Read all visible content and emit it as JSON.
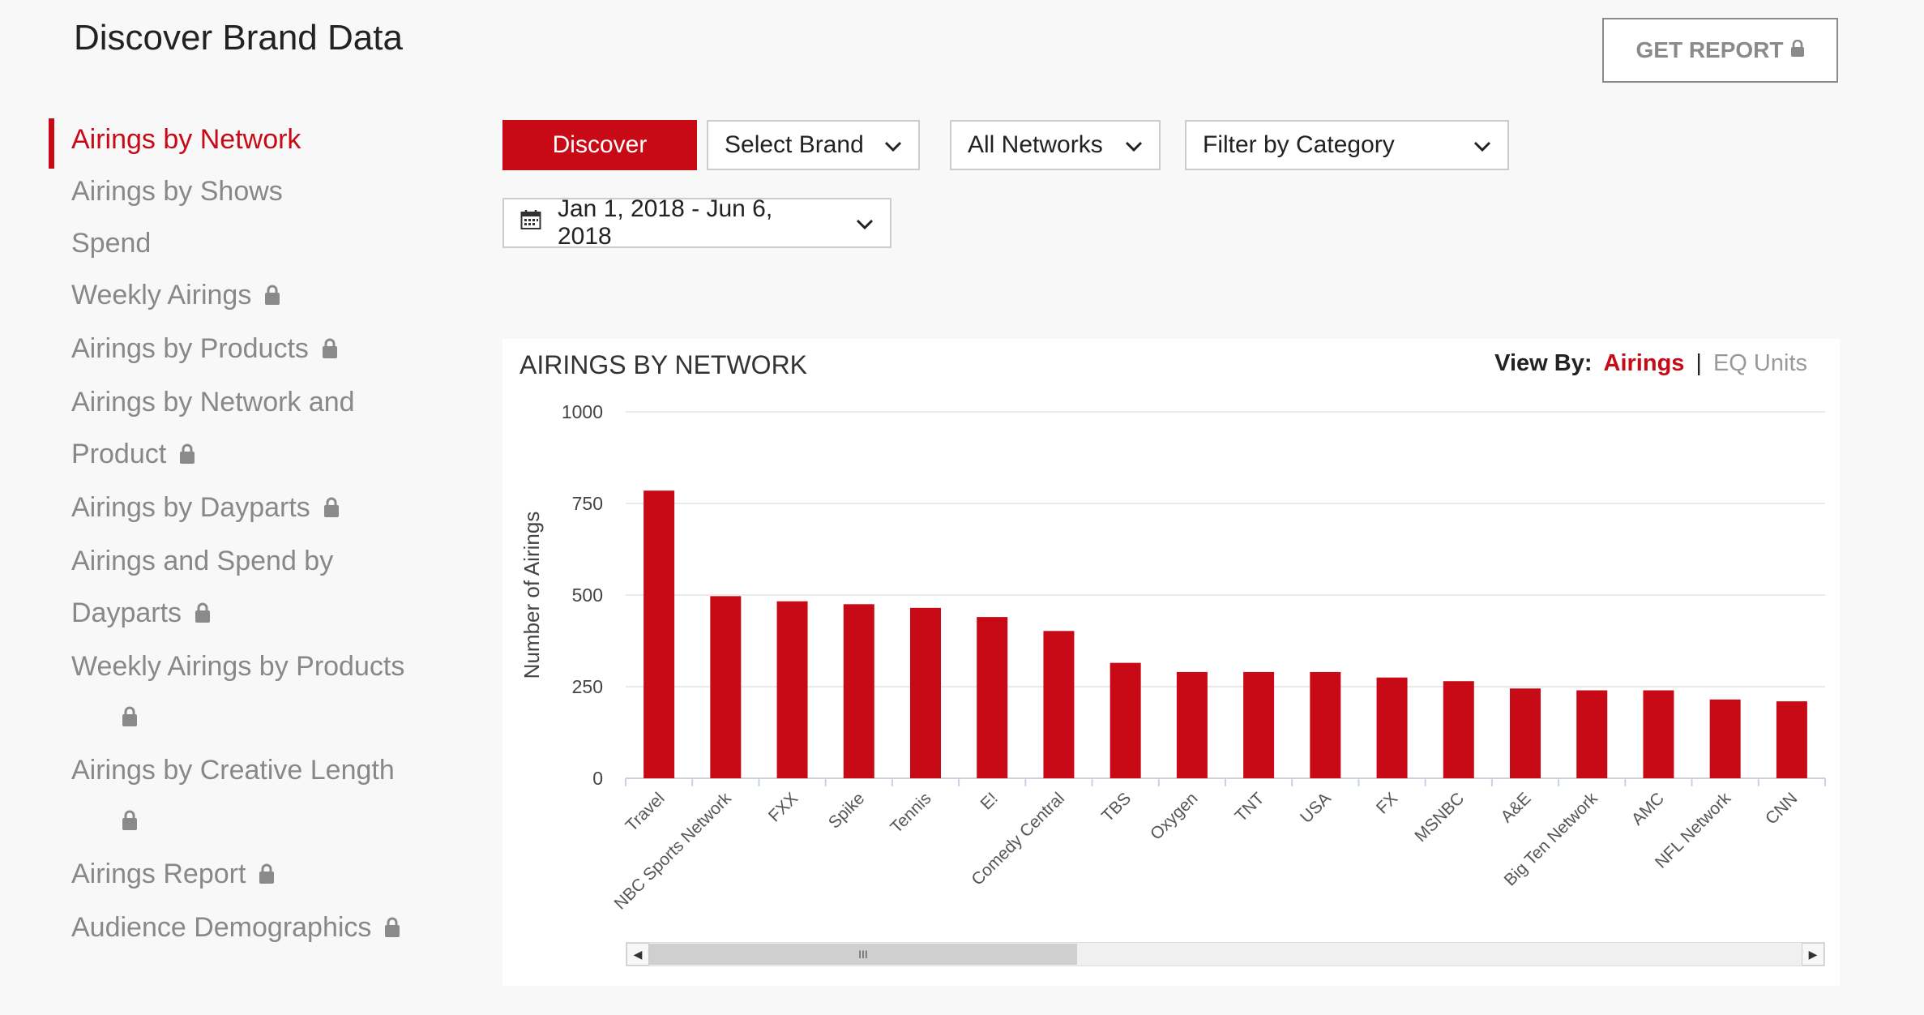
{
  "page": {
    "title": "Discover Brand Data"
  },
  "header": {
    "get_report_label": "GET REPORT",
    "get_report_icon": "lock-icon"
  },
  "sidebar": {
    "items": [
      {
        "label": "Airings by Network",
        "active": true,
        "locked": false
      },
      {
        "label": "Airings by Shows",
        "locked": false
      },
      {
        "label": "Spend",
        "locked": false
      },
      {
        "label": "Weekly Airings",
        "locked": true
      },
      {
        "label": "Airings by Products",
        "locked": true
      },
      {
        "label": "Airings by Network and",
        "label2": "Product",
        "locked": true
      },
      {
        "label": "Airings by Dayparts",
        "locked": true
      },
      {
        "label": "Airings and Spend by",
        "label2": "Dayparts",
        "locked": true
      },
      {
        "label": "Weekly Airings by Products",
        "locked": true,
        "lock_on_new_line": true
      },
      {
        "label": "Airings by Creative Length",
        "locked": true,
        "lock_on_new_line": true
      },
      {
        "label": "Airings Report",
        "locked": true
      },
      {
        "label": "Audience Demographics",
        "locked": true
      }
    ]
  },
  "controls": {
    "discover_label": "Discover",
    "brand_select": "Select Brand",
    "networks_select": "All Networks",
    "category_select": "Filter by Category",
    "date_range": "Jan 1, 2018 - Jun 6, 2018"
  },
  "chart_panel": {
    "title": "AIRINGS BY NETWORK",
    "view_by_label": "View By:",
    "view_by_active": "Airings",
    "view_by_separator": "|",
    "view_by_other": "EQ Units",
    "scroll_thumb_glyph": "III"
  },
  "colors": {
    "accent": "#c80a17",
    "bar": "#c80a17",
    "grid": "#e4e4e4"
  },
  "chart_data": {
    "type": "bar",
    "title": "AIRINGS BY NETWORK",
    "xlabel": "",
    "ylabel": "Number of Airings",
    "ylim": [
      0,
      1000
    ],
    "yticks": [
      0,
      250,
      500,
      750,
      1000
    ],
    "grid": true,
    "categories": [
      "Travel",
      "NBC Sports Network",
      "FXX",
      "Spike",
      "Tennis",
      "E!",
      "Comedy Central",
      "TBS",
      "Oxygen",
      "TNT",
      "USA",
      "FX",
      "MSNBC",
      "A&E",
      "Big Ten Network",
      "AMC",
      "NFL Network",
      "CNN"
    ],
    "values": [
      785,
      497,
      483,
      475,
      465,
      440,
      402,
      315,
      290,
      290,
      290,
      275,
      265,
      245,
      240,
      240,
      215,
      210
    ]
  }
}
